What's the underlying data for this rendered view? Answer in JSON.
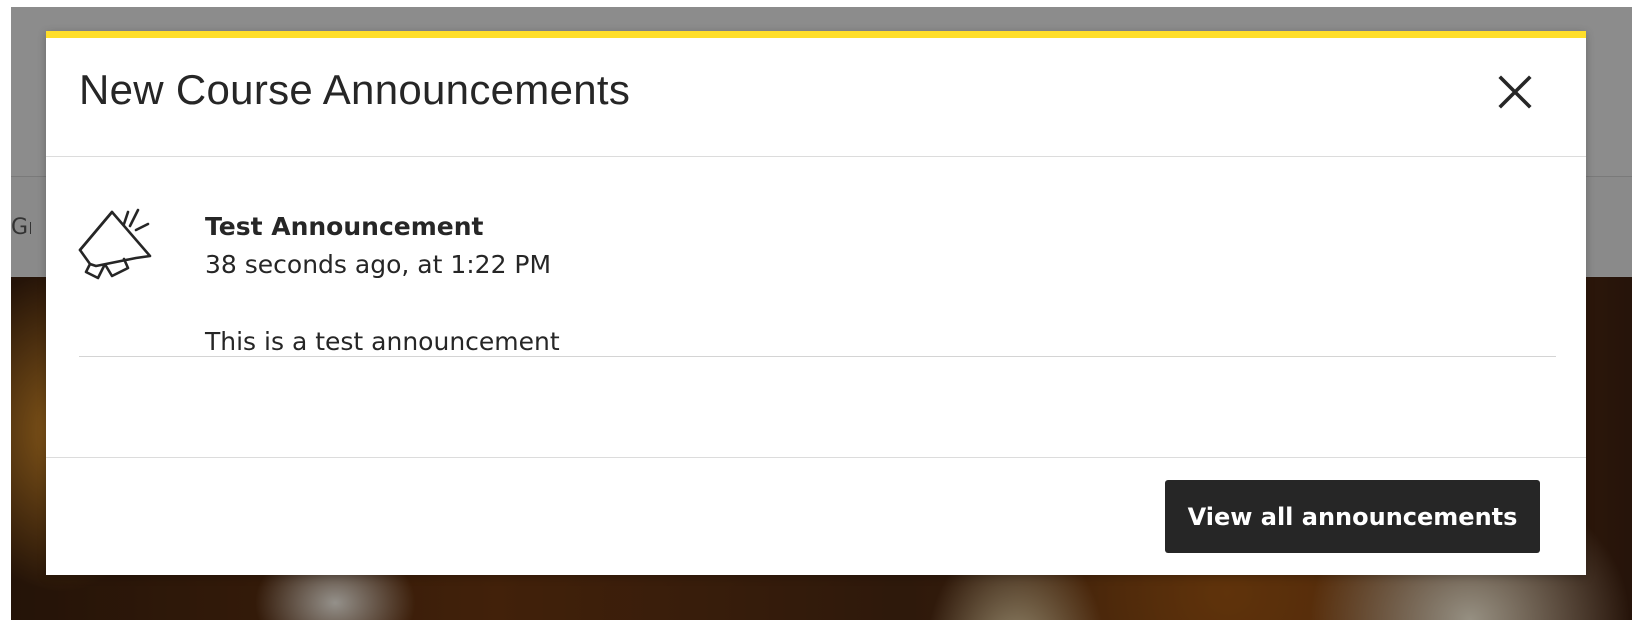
{
  "background": {
    "nav_partial_label": "Gra"
  },
  "modal": {
    "title": "New Course Announcements",
    "accent_color": "#ffde2a",
    "close_icon": "close-icon",
    "announcements": [
      {
        "icon": "megaphone-icon",
        "title": "Test Announcement",
        "time": "38 seconds ago, at 1:22 PM",
        "body": "This is a test announcement"
      }
    ],
    "view_all_label": "View all announcements"
  }
}
